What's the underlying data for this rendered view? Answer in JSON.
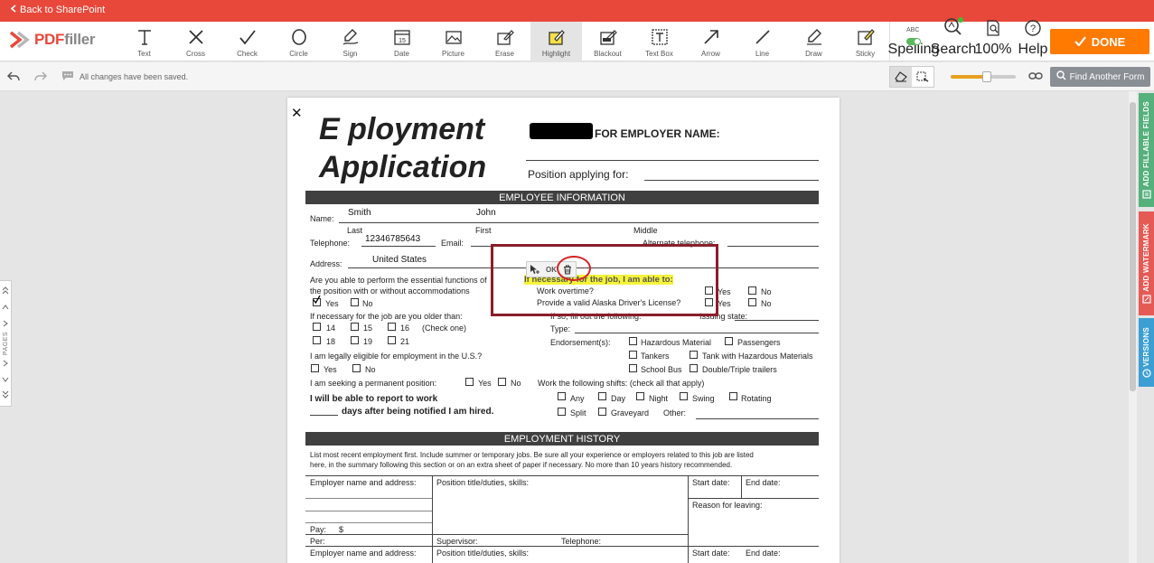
{
  "topbar": {
    "back_label": "Back to SharePoint"
  },
  "logo": {
    "pdf": "PDF",
    "filler": "filler"
  },
  "tools": [
    {
      "label": "Text",
      "icon": "text-icon"
    },
    {
      "label": "Cross",
      "icon": "cross-icon"
    },
    {
      "label": "Check",
      "icon": "check-icon"
    },
    {
      "label": "Circle",
      "icon": "circle-icon"
    },
    {
      "label": "Sign",
      "icon": "sign-icon"
    },
    {
      "label": "Date",
      "icon": "date-icon"
    },
    {
      "label": "Picture",
      "icon": "picture-icon"
    },
    {
      "label": "Erase",
      "icon": "erase-icon"
    },
    {
      "label": "Highlight",
      "icon": "highlight-icon"
    },
    {
      "label": "Blackout",
      "icon": "blackout-icon"
    },
    {
      "label": "Text Box",
      "icon": "textbox-icon"
    },
    {
      "label": "Arrow",
      "icon": "arrow-icon"
    },
    {
      "label": "Line",
      "icon": "line-icon"
    },
    {
      "label": "Draw",
      "icon": "draw-icon"
    },
    {
      "label": "Sticky",
      "icon": "sticky-icon"
    }
  ],
  "tools2": [
    {
      "label": "Spelling",
      "icon": "spelling-icon",
      "top": "ABC"
    },
    {
      "label": "Search",
      "icon": "search-icon"
    },
    {
      "label": "100%",
      "icon": "zoom-icon"
    },
    {
      "label": "Help",
      "icon": "help-icon"
    }
  ],
  "done_label": "DONE",
  "subbar": {
    "saved_text": "All changes have been saved.",
    "find_label": "Find Another Form",
    "zoom_level": 0.55
  },
  "pages_label": "PAGES",
  "right_tabs": {
    "fillable": "ADD FILLABLE FIELDS",
    "watermark": "ADD WATERMARK",
    "versions": "VERSIONS"
  },
  "selection": {
    "ok": "OK"
  },
  "form": {
    "title_line1": "E   ployment",
    "title_line2": "Application",
    "employer_name_label": "FOR EMPLOYER NAME:",
    "position_label": "Position applying for:",
    "employee_info": "EMPLOYEE INFORMATION",
    "name_label": "Name:",
    "last_value": "Smith",
    "first_value": "John",
    "last": "Last",
    "first": "First",
    "middle": "Middle",
    "telephone_label": "Telephone:",
    "telephone_value": "12346785643",
    "email_label": "Email:",
    "alt_tel_label": "Alternate telephone:",
    "address_label": "Address:",
    "address_value": "United States",
    "q_perform_1": "Are you able to perform the essential functions of",
    "q_perform_2": "the position with or without accommodations",
    "yes": "Yes",
    "no": "No",
    "highlight_text": "If necessary for the job, I am able to:",
    "work_overtime": "Work overtime?",
    "valid_license": "Provide a valid Alaska Driver's License?",
    "older_than": "If necessary for the job are you older than:",
    "ages": [
      "14",
      "15",
      "16",
      "18",
      "19",
      "21"
    ],
    "check_one": "(Check one)",
    "if_so": "If so, fill out the following:",
    "issuing_state": "Issuing state:",
    "type_label": "Type:",
    "endorsements": "Endorsement(s):",
    "hazmat": "Hazardous Material",
    "passengers": "Passengers",
    "tankers": "Tankers",
    "tank_hazmat": "Tank with Hazardous Materials",
    "school_bus": "School Bus",
    "double_triple": "Double/Triple trailers",
    "legally_eligible": "I am legally eligible for employment in the U.S.?",
    "permanent": "I am seeking a permanent position:",
    "shifts": "Work the following shifts: (check all that apply)",
    "shift_any": "Any",
    "shift_day": "Day",
    "shift_night": "Night",
    "shift_swing": "Swing",
    "shift_rotating": "Rotating",
    "shift_split": "Split",
    "shift_graveyard": "Graveyard",
    "other_label": "Other:",
    "report_1": "I will be able to report to work",
    "report_2": "days after being notified I am hired.",
    "employment_history": "EMPLOYMENT HISTORY",
    "history_note_1": "List most recent employment first. Include summer or temporary jobs. Be sure all your experience or employers related to this job are listed",
    "history_note_2": "here, in the summary following this section or on an extra sheet of paper if necessary. No more than 10 years history recommended.",
    "employer_addr": "Employer name and address:",
    "position_title": "Position title/duties, skills:",
    "start_date": "Start date:",
    "end_date": "End date:",
    "reason_leaving": "Reason for leaving:",
    "pay": "Pay:",
    "dollar": "$",
    "per": "Per:",
    "supervisor": "Supervisor:",
    "telephone2": "Telephone:"
  }
}
